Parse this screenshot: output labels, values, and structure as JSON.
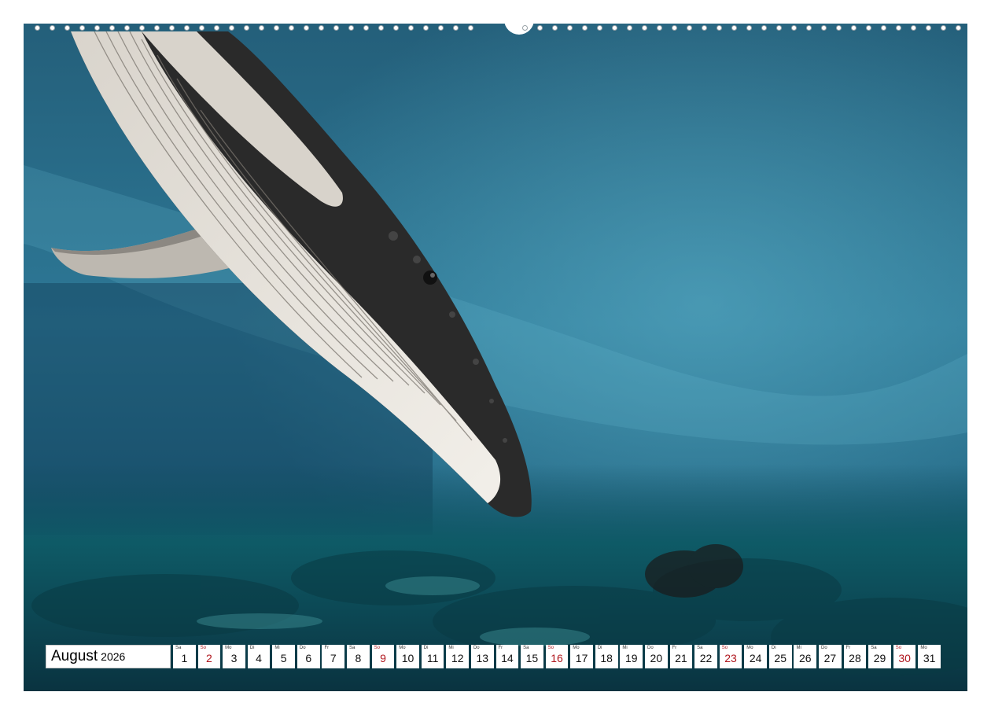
{
  "calendar": {
    "month": "August",
    "year": "2026",
    "days": [
      {
        "wd": "Sa",
        "d": "1",
        "sunday": false
      },
      {
        "wd": "So",
        "d": "2",
        "sunday": true
      },
      {
        "wd": "Mo",
        "d": "3",
        "sunday": false
      },
      {
        "wd": "Di",
        "d": "4",
        "sunday": false
      },
      {
        "wd": "Mi",
        "d": "5",
        "sunday": false
      },
      {
        "wd": "Do",
        "d": "6",
        "sunday": false
      },
      {
        "wd": "Fr",
        "d": "7",
        "sunday": false
      },
      {
        "wd": "Sa",
        "d": "8",
        "sunday": false
      },
      {
        "wd": "So",
        "d": "9",
        "sunday": true
      },
      {
        "wd": "Mo",
        "d": "10",
        "sunday": false
      },
      {
        "wd": "Di",
        "d": "11",
        "sunday": false
      },
      {
        "wd": "Mi",
        "d": "12",
        "sunday": false
      },
      {
        "wd": "Do",
        "d": "13",
        "sunday": false
      },
      {
        "wd": "Fr",
        "d": "14",
        "sunday": false
      },
      {
        "wd": "Sa",
        "d": "15",
        "sunday": false
      },
      {
        "wd": "So",
        "d": "16",
        "sunday": true
      },
      {
        "wd": "Mo",
        "d": "17",
        "sunday": false
      },
      {
        "wd": "Di",
        "d": "18",
        "sunday": false
      },
      {
        "wd": "Mi",
        "d": "19",
        "sunday": false
      },
      {
        "wd": "Do",
        "d": "20",
        "sunday": false
      },
      {
        "wd": "Fr",
        "d": "21",
        "sunday": false
      },
      {
        "wd": "Sa",
        "d": "22",
        "sunday": false
      },
      {
        "wd": "So",
        "d": "23",
        "sunday": true
      },
      {
        "wd": "Mo",
        "d": "24",
        "sunday": false
      },
      {
        "wd": "Di",
        "d": "25",
        "sunday": false
      },
      {
        "wd": "Mi",
        "d": "26",
        "sunday": false
      },
      {
        "wd": "Do",
        "d": "27",
        "sunday": false
      },
      {
        "wd": "Fr",
        "d": "28",
        "sunday": false
      },
      {
        "wd": "Sa",
        "d": "29",
        "sunday": false
      },
      {
        "wd": "So",
        "d": "30",
        "sunday": true
      },
      {
        "wd": "Mo",
        "d": "31",
        "sunday": false
      }
    ]
  },
  "colors": {
    "sunday": "#b0161d",
    "water_deep": "#0d3f58",
    "water_light": "#3a8aa8",
    "whale_dark": "#2a2a2a",
    "whale_light": "#e8e4de"
  },
  "photo": {
    "subject": "humpback-whale",
    "scene": "underwater-reef"
  }
}
